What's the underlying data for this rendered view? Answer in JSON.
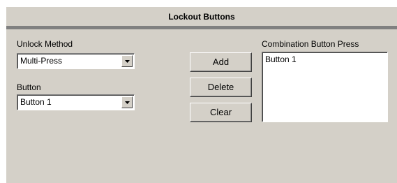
{
  "panel": {
    "title": "Lockout Buttons"
  },
  "unlock_method": {
    "label": "Unlock Method",
    "value": "Multi-Press"
  },
  "button_select": {
    "label": "Button",
    "value": "Button 1"
  },
  "actions": {
    "add": "Add",
    "delete": "Delete",
    "clear": "Clear"
  },
  "combination": {
    "label": "Combination Button Press",
    "items": [
      "Button 1"
    ]
  },
  "icons": {
    "dropdown": "chevron-down-icon"
  }
}
